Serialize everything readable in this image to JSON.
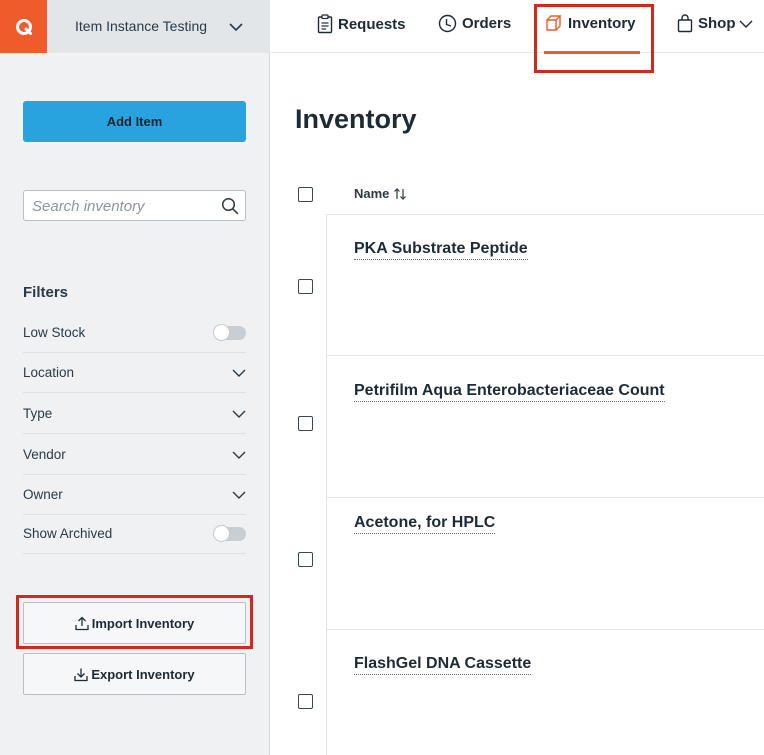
{
  "org": {
    "name": "Item Instance Testing"
  },
  "nav": {
    "items": [
      {
        "label": "Requests",
        "icon": "clipboard-icon"
      },
      {
        "label": "Orders",
        "icon": "clock-icon"
      },
      {
        "label": "Inventory",
        "icon": "box-icon",
        "active": true
      },
      {
        "label": "Shop",
        "icon": "bag-icon"
      }
    ],
    "accent_color": "#ef5b2b"
  },
  "sidebar": {
    "add_button_label": "Add Item",
    "search_placeholder": "Search inventory",
    "filters_title": "Filters",
    "filters": [
      {
        "label": "Low Stock",
        "kind": "toggle",
        "value": false
      },
      {
        "label": "Location",
        "kind": "dropdown"
      },
      {
        "label": "Type",
        "kind": "dropdown"
      },
      {
        "label": "Vendor",
        "kind": "dropdown"
      },
      {
        "label": "Owner",
        "kind": "dropdown"
      },
      {
        "label": "Show Archived",
        "kind": "toggle",
        "value": false
      }
    ],
    "import_label": "Import Inventory",
    "export_label": "Export Inventory"
  },
  "main": {
    "title": "Inventory",
    "column_name": "Name",
    "rows": [
      {
        "name": "PKA Substrate Peptide"
      },
      {
        "name": "Petrifilm Aqua Enterobacteriaceae Count"
      },
      {
        "name": "Acetone, for HPLC"
      },
      {
        "name": "FlashGel DNA Cassette"
      }
    ]
  },
  "colors": {
    "primary_button": "#29a3e0",
    "highlight": "#d22a1a",
    "brand": "#ef5b2b"
  }
}
